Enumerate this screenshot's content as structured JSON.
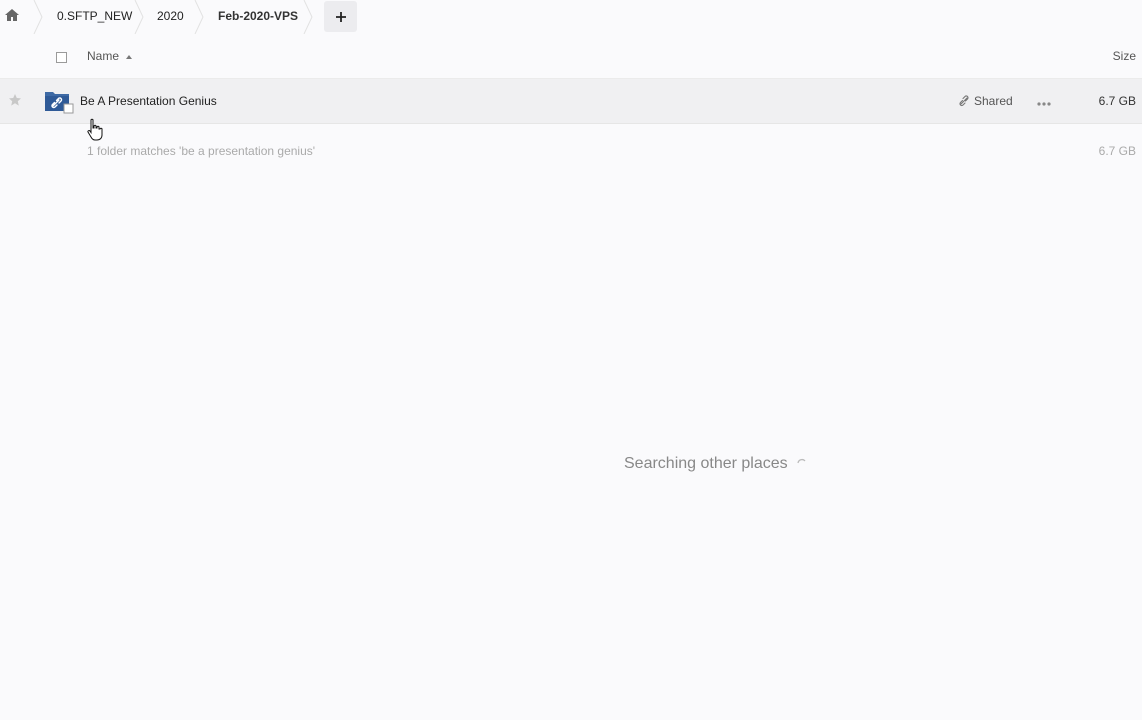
{
  "breadcrumb": {
    "items": [
      {
        "label": "0.SFTP_NEW"
      },
      {
        "label": "2020"
      },
      {
        "label": "Feb-2020-VPS"
      }
    ],
    "add_label": "+"
  },
  "header": {
    "name_label": "Name",
    "size_label": "Size"
  },
  "files": [
    {
      "name": "Be A Presentation Genius",
      "shared_label": "Shared",
      "size": "6.7 GB",
      "type": "shared-folder"
    }
  ],
  "summary": {
    "text": "1 folder matches 'be a presentation genius'",
    "size": "6.7 GB"
  },
  "status": {
    "searching_text": "Searching other places"
  }
}
